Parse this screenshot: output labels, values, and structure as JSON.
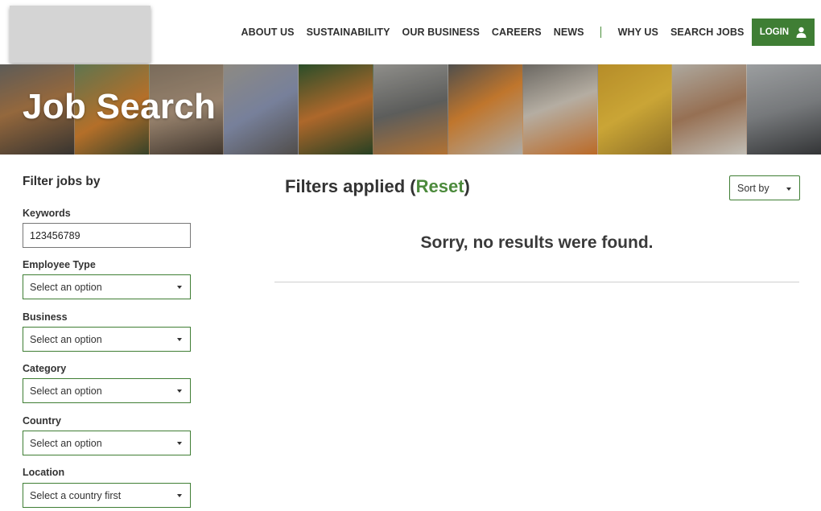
{
  "header": {
    "nav": [
      {
        "label": "ABOUT US"
      },
      {
        "label": "SUSTAINABILITY"
      },
      {
        "label": "OUR BUSINESS"
      },
      {
        "label": "CAREERS"
      },
      {
        "label": "NEWS"
      }
    ],
    "secondary_nav": [
      {
        "label": "WHY US"
      },
      {
        "label": "SEARCH JOBS"
      }
    ],
    "login_label": "LOGIN",
    "accent_color": "#3f7e34"
  },
  "banner": {
    "title": "Job Search"
  },
  "sidebar": {
    "heading": "Filter jobs by",
    "keywords": {
      "label": "Keywords",
      "value": "123456789"
    },
    "employee_type": {
      "label": "Employee Type",
      "value": "Select an option"
    },
    "business": {
      "label": "Business",
      "value": "Select an option"
    },
    "category": {
      "label": "Category",
      "value": "Select an option"
    },
    "country": {
      "label": "Country",
      "value": "Select an option"
    },
    "location": {
      "label": "Location",
      "value": "Select a country first"
    }
  },
  "main": {
    "filters_prefix": "Filters applied (",
    "reset_label": "Reset",
    "filters_suffix": ")",
    "sort_label": "Sort by",
    "no_results": "Sorry, no results were found."
  }
}
